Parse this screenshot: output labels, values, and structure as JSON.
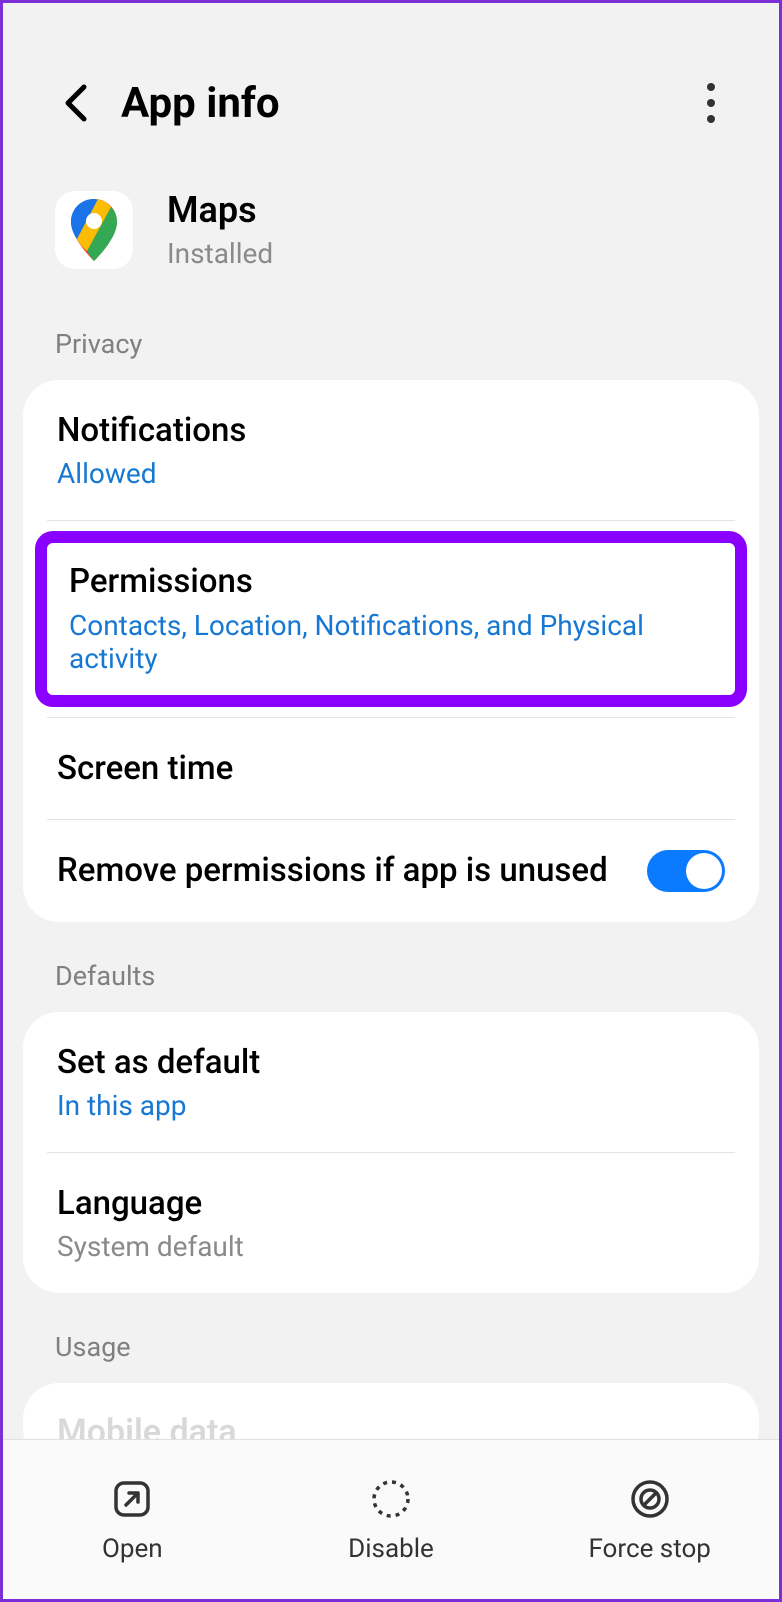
{
  "header": {
    "title": "App info"
  },
  "app": {
    "name": "Maps",
    "status": "Installed"
  },
  "sections": {
    "privacy": {
      "label": "Privacy",
      "notifications": {
        "title": "Notifications",
        "value": "Allowed"
      },
      "permissions": {
        "title": "Permissions",
        "value": "Contacts, Location, Notifications, and Physical activity"
      },
      "screen_time": {
        "title": "Screen time"
      },
      "remove_perms": {
        "title": "Remove permissions if app is unused",
        "enabled": true
      }
    },
    "defaults": {
      "label": "Defaults",
      "set_default": {
        "title": "Set as default",
        "value": "In this app"
      },
      "language": {
        "title": "Language",
        "value": "System default"
      }
    },
    "usage": {
      "label": "Usage",
      "mobile_data": {
        "title": "Mobile data"
      }
    }
  },
  "actions": {
    "open": "Open",
    "disable": "Disable",
    "force_stop": "Force stop"
  }
}
